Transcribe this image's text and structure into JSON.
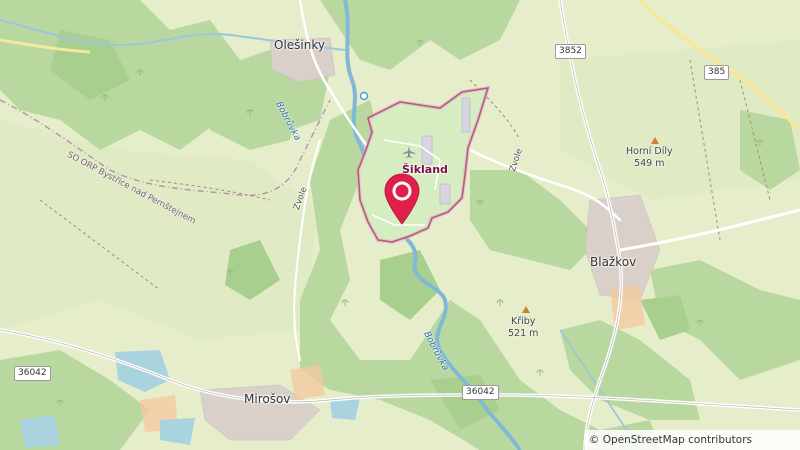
{
  "map": {
    "towns": {
      "olesinky": "Olešinky",
      "blazkov": "Blažkov",
      "mirosov": "Mirošov"
    },
    "peaks": {
      "horni_dily": {
        "name": "Horní Díly",
        "elevation": "549 m"
      },
      "kriby": {
        "name": "Křiby",
        "elevation": "521 m"
      }
    },
    "rivers": {
      "bobruvka_north": "Bobrůvka",
      "bobruvka_south": "Bobrůvka"
    },
    "boundary_label": "SO ORP Bystřice nad Pernštejnem",
    "road_names": {
      "zvole_west": "Zvole",
      "zvole_east": "Zvole"
    },
    "road_refs": {
      "r3852": "3852",
      "r385": "385",
      "r36042_west": "36042",
      "r36042_east": "36042"
    },
    "selected_area": {
      "name": "Šikland",
      "marker_color": "#e0204b",
      "outline_color": "#7a1146"
    },
    "attribution": "© OpenStreetMap contributors"
  }
}
